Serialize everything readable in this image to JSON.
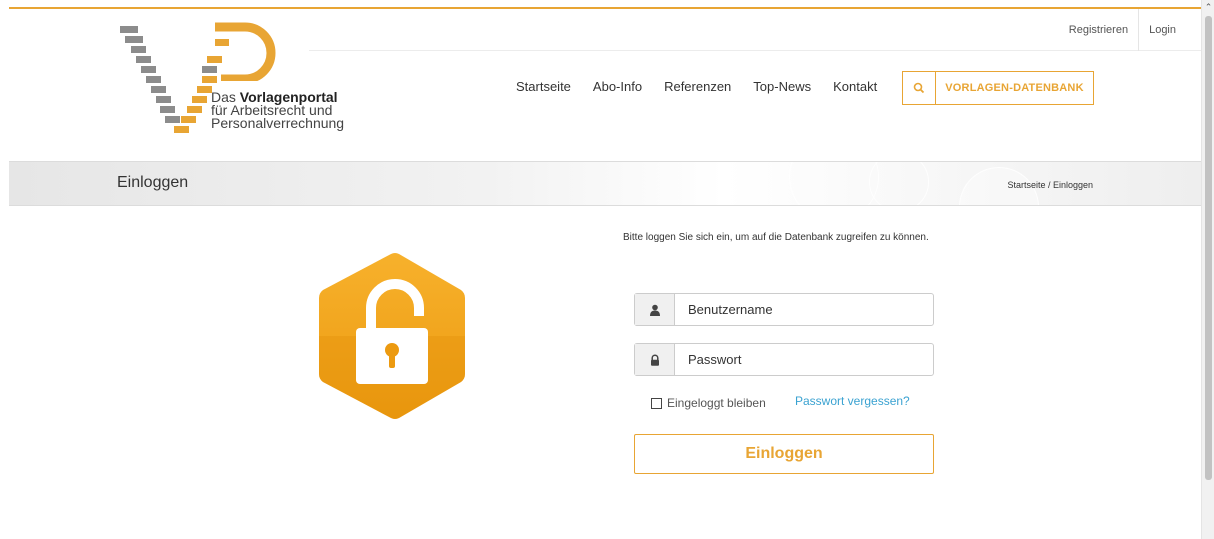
{
  "header": {
    "top_links": {
      "register": "Registrieren",
      "login": "Login"
    },
    "logo": {
      "line1_prefix": "Das ",
      "line1_bold": "Vorlagenportal",
      "line2": "für Arbeitsrecht und",
      "line3": "Personalverrechnung"
    },
    "nav": [
      "Startseite",
      "Abo-Info",
      "Referenzen",
      "Top-News",
      "Kontakt"
    ],
    "database_button": {
      "label": "VORLAGEN-DATENBANK",
      "icon": "search-icon"
    }
  },
  "title_bar": {
    "title": "Einloggen",
    "breadcrumb": "Startseite / Einloggen"
  },
  "login": {
    "intro": "Bitte loggen Sie sich ein, um auf die Datenbank zugreifen zu können.",
    "username": {
      "placeholder": "Benutzername",
      "value": "",
      "icon": "user-icon"
    },
    "password": {
      "placeholder": "Passwort",
      "value": "",
      "icon": "lock-icon"
    },
    "remember_label": "Eingeloggt bleiben",
    "remember_checked": false,
    "forgot_label": "Passwort vergessen?",
    "submit_label": "Einloggen"
  },
  "colors": {
    "accent": "#e8a534",
    "link": "#3aa2d1"
  }
}
